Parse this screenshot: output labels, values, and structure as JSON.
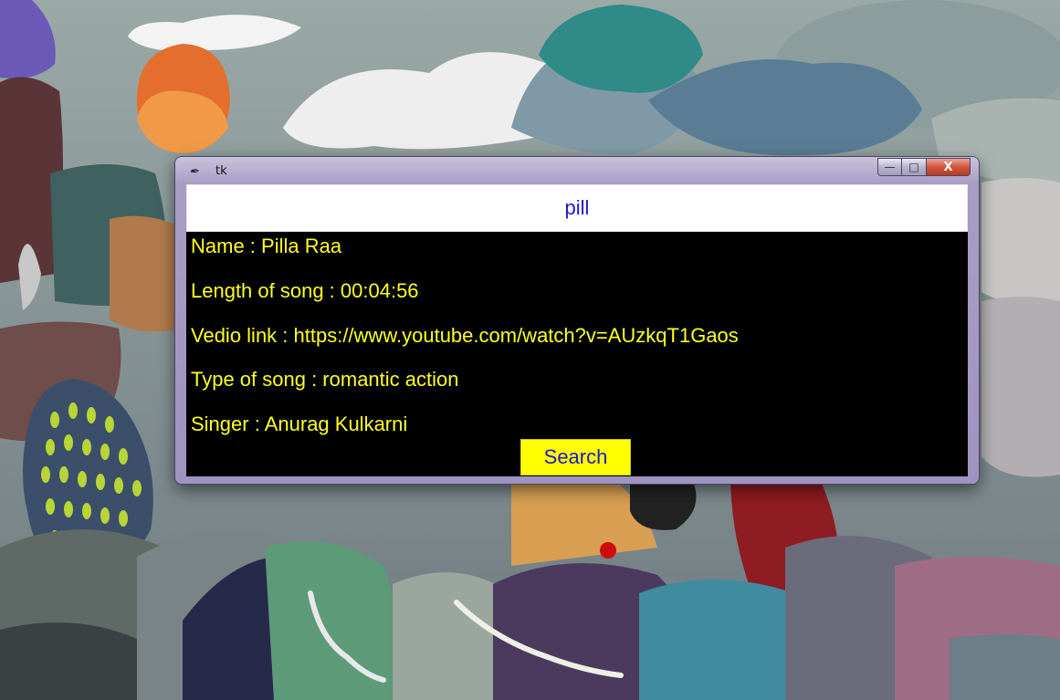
{
  "window": {
    "title": "tk",
    "icon": "feather-icon",
    "controls": {
      "minimize": "—",
      "maximize": "□",
      "close": "X"
    }
  },
  "search": {
    "value": "pill"
  },
  "result": {
    "name": "Name : Pilla Raa",
    "length": "Length of song : 00:04:56",
    "link": "Vedio link : https://www.youtube.com/watch?v=AUzkqT1Gaos",
    "type": "Type of song : romantic action",
    "singer": "Singer : Anurag Kulkarni"
  },
  "button": {
    "label": "Search"
  },
  "colors": {
    "client_bg": "#000000",
    "result_text": "#ffff22",
    "input_text": "#1c17d6",
    "button_bg": "#ffff00",
    "button_text": "#1c17d6"
  }
}
